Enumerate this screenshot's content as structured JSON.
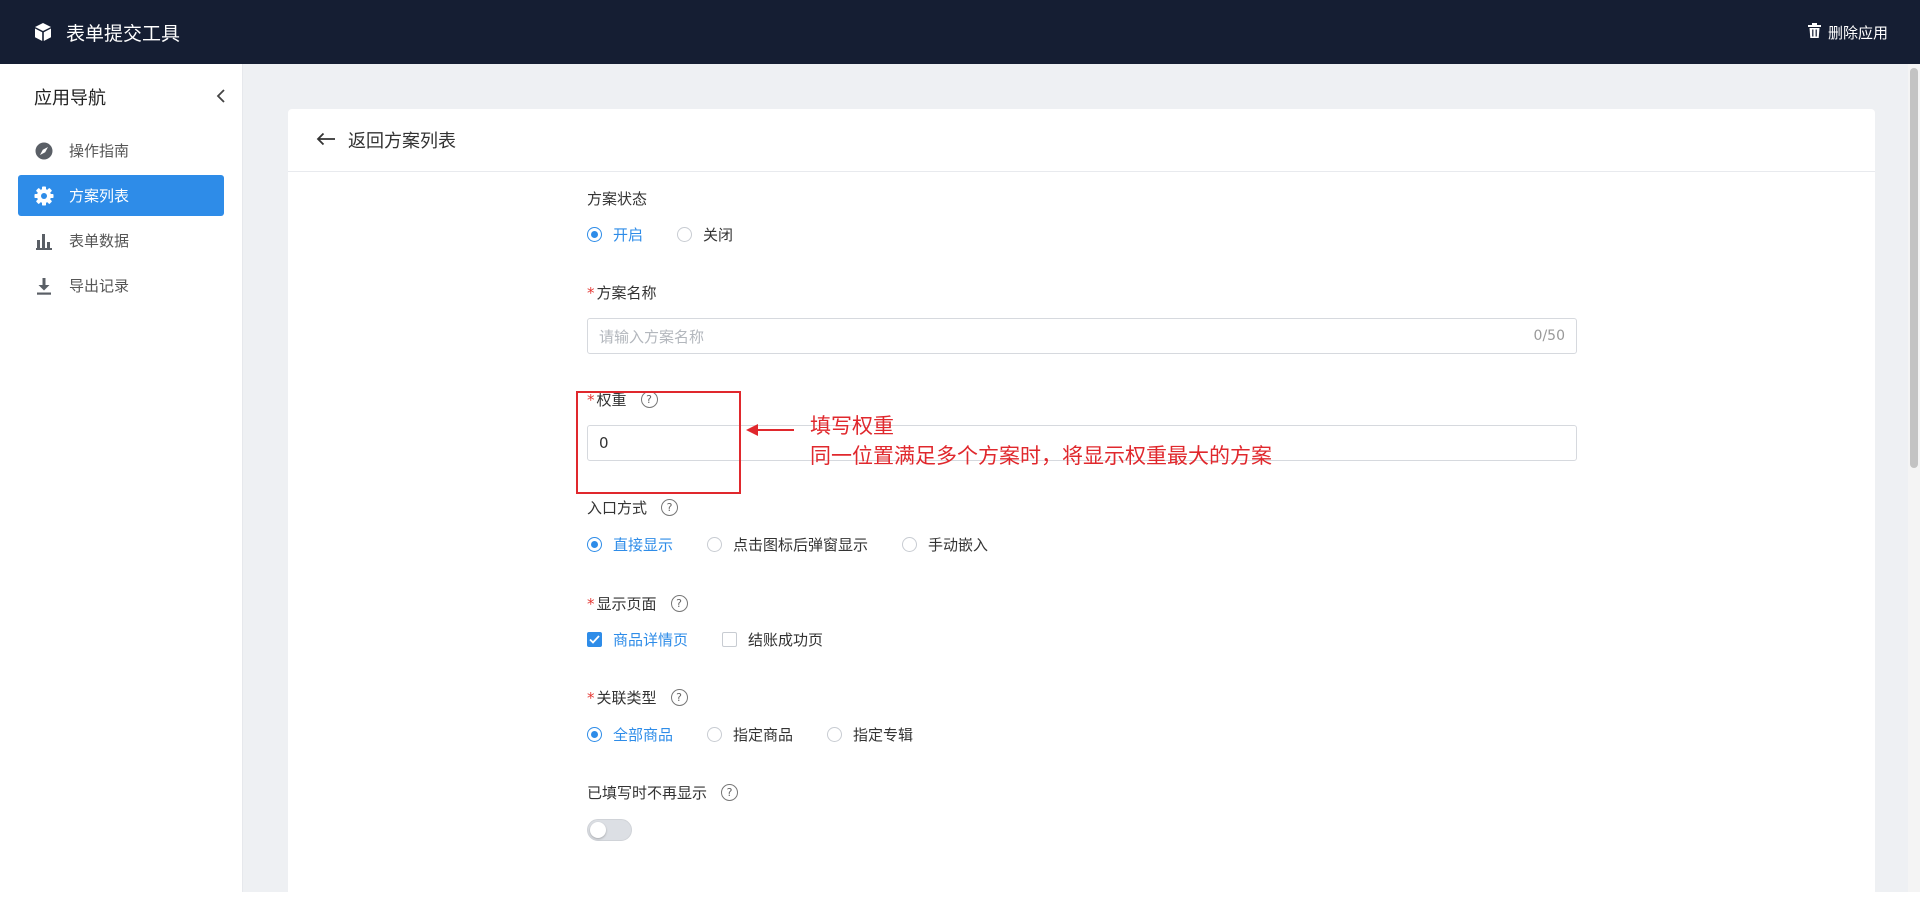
{
  "header": {
    "app_title": "表单提交工具",
    "delete_label": "删除应用"
  },
  "sidebar": {
    "title": "应用导航",
    "items": [
      {
        "label": "操作指南",
        "icon": "compass-icon",
        "active": false
      },
      {
        "label": "方案列表",
        "icon": "gear-icon",
        "active": true
      },
      {
        "label": "表单数据",
        "icon": "bar-chart-icon",
        "active": false
      },
      {
        "label": "导出记录",
        "icon": "download-icon",
        "active": false
      }
    ]
  },
  "card": {
    "back_label": "返回方案列表"
  },
  "form": {
    "status": {
      "label": "方案状态",
      "options": [
        "开启",
        "关闭"
      ],
      "selected": "开启"
    },
    "name": {
      "label": "方案名称",
      "required": true,
      "placeholder": "请输入方案名称",
      "count": "0/50"
    },
    "weight": {
      "label": "权重",
      "required": true,
      "value": "0",
      "help": "?"
    },
    "entry": {
      "label": "入口方式",
      "options": [
        "直接显示",
        "点击图标后弹窗显示",
        "手动嵌入"
      ],
      "selected": "直接显示",
      "help": "?"
    },
    "pages": {
      "label": "显示页面",
      "required": true,
      "options": [
        "商品详情页",
        "结账成功页"
      ],
      "checked": [
        "商品详情页"
      ],
      "help": "?"
    },
    "relation": {
      "label": "关联类型",
      "required": true,
      "options": [
        "全部商品",
        "指定商品",
        "指定专辑"
      ],
      "selected": "全部商品",
      "help": "?"
    },
    "hide_after": {
      "label": "已填写时不再显示",
      "enabled": false,
      "help": "?"
    }
  },
  "annotation": {
    "line1": "填写权重",
    "line2": "同一位置满足多个方案时，将显示权重最大的方案"
  },
  "colors": {
    "topbar": "#151e33",
    "accent": "#2e8ce8",
    "annotation": "#e0282d",
    "required": "#e53935"
  }
}
